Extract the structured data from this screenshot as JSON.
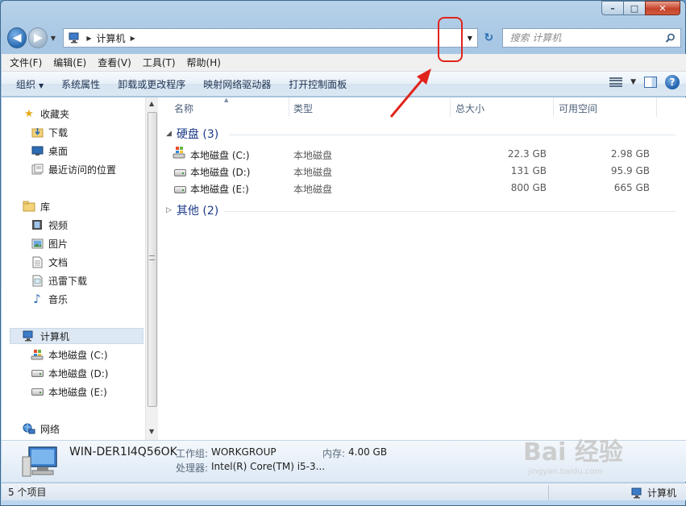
{
  "window": {
    "minimize": "–",
    "maximize": "□",
    "close": "✕"
  },
  "navigation": {
    "back": "◀",
    "forward": "▶",
    "breadcrumb": [
      "计算机"
    ],
    "address_dropdown": "▼",
    "refresh": "↻",
    "search_placeholder": "搜索 计算机"
  },
  "menubar": [
    "文件(F)",
    "编辑(E)",
    "查看(V)",
    "工具(T)",
    "帮助(H)"
  ],
  "commandbar": {
    "organize": "组织",
    "system_properties": "系统属性",
    "uninstall": "卸载或更改程序",
    "map_drive": "映射网络驱动器",
    "control_panel": "打开控制面板"
  },
  "nav_pane": {
    "favorites": {
      "label": "收藏夹",
      "items": [
        "下载",
        "桌面",
        "最近访问的位置"
      ]
    },
    "libraries": {
      "label": "库",
      "items": [
        "视频",
        "图片",
        "文档",
        "迅雷下载",
        "音乐"
      ]
    },
    "computer": {
      "label": "计算机",
      "items": [
        "本地磁盘 (C:)",
        "本地磁盘 (D:)",
        "本地磁盘 (E:)"
      ]
    },
    "network": {
      "label": "网络"
    }
  },
  "columns": [
    "名称",
    "类型",
    "总大小",
    "可用空间"
  ],
  "groups": {
    "hard_disks": {
      "label": "硬盘 (3)"
    },
    "other": {
      "label": "其他 (2)"
    }
  },
  "drives": [
    {
      "name": "本地磁盘 (C:)",
      "type": "本地磁盘",
      "total": "22.3 GB",
      "free": "2.98 GB"
    },
    {
      "name": "本地磁盘 (D:)",
      "type": "本地磁盘",
      "total": "131 GB",
      "free": "95.9 GB"
    },
    {
      "name": "本地磁盘 (E:)",
      "type": "本地磁盘",
      "total": "800 GB",
      "free": "665 GB"
    }
  ],
  "details": {
    "computer_name": "WIN-DER1I4Q56OK",
    "workgroup_label": "工作组:",
    "workgroup_value": "WORKGROUP",
    "memory_label": "内存:",
    "memory_value": "4.00 GB",
    "processor_label": "处理器:",
    "processor_value": "Intel(R) Core(TM) i5-3..."
  },
  "statusbar": {
    "count": "5 个项目",
    "location": "计算机"
  },
  "watermark": {
    "brand": "Bai 经验",
    "url": "jingyan.baidu.com"
  },
  "colors": {
    "annotation_red": "#e0241c",
    "group_blue": "#1e3b8a"
  }
}
